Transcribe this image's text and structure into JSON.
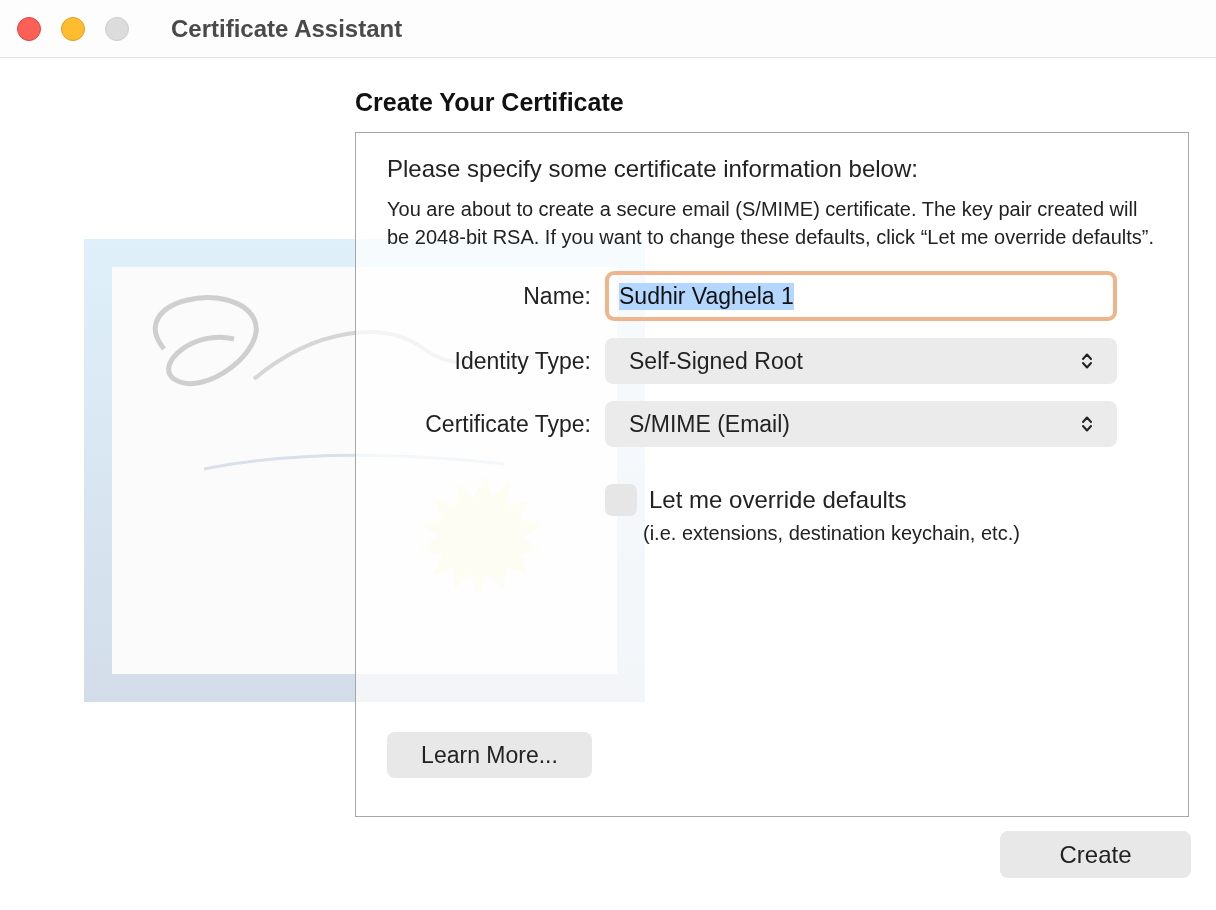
{
  "window": {
    "title": "Certificate Assistant"
  },
  "heading": "Create Your Certificate",
  "panel": {
    "intro": "Please specify some certificate information below:",
    "description": "You are about to create a secure email (S/MIME) certificate. The key pair created will be 2048-bit RSA. If you want to change these defaults, click “Let me override defaults”.",
    "fields": [
      {
        "kind": "text",
        "label": "Name:",
        "value": "Sudhir Vaghela 1",
        "focused": true,
        "text_highlighted": true
      },
      {
        "kind": "popup",
        "label": "Identity Type:",
        "value": "Self-Signed Root"
      },
      {
        "kind": "popup",
        "label": "Certificate Type:",
        "value": "S/MIME (Email)"
      }
    ],
    "override": {
      "label": "Let me override defaults",
      "note": "(i.e. extensions, destination keychain, etc.)",
      "checked": false
    },
    "learn_more": "Learn More..."
  },
  "create_button": "Create"
}
